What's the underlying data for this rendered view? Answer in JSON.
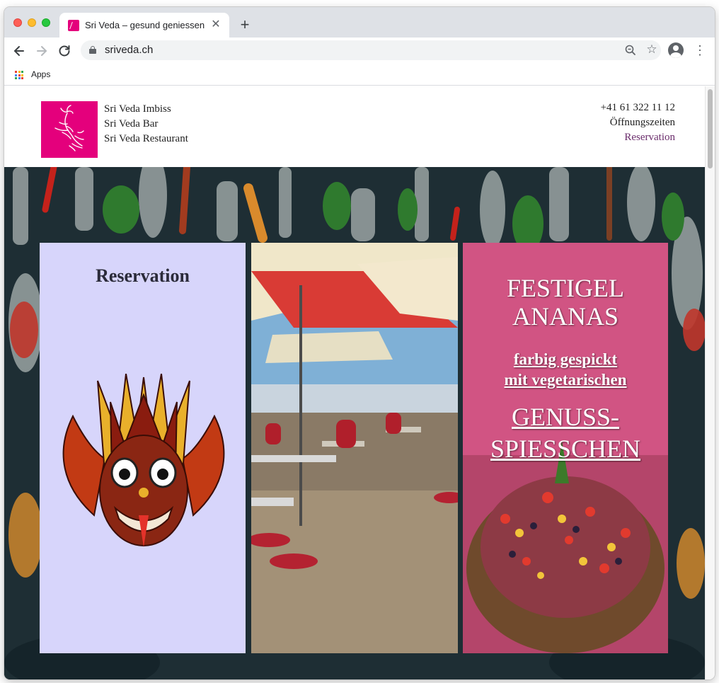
{
  "browser": {
    "tab_title": "Sri Veda – gesund geniessen",
    "url": "sriveda.ch",
    "bookmarks": [
      {
        "label": "Apps"
      }
    ]
  },
  "header": {
    "nav": [
      "Sri Veda Imbiss",
      "Sri Veda Bar",
      "Sri Veda Restaurant"
    ],
    "phone": "+41 61 322 11 12",
    "hours_label": "Öffnungszeiten",
    "reservation_label": "Reservation"
  },
  "panels": {
    "reservation": {
      "title": "Reservation"
    },
    "promo": {
      "title_line1": "FESTIGEL",
      "title_line2": "ANANAS",
      "sub_line1": "farbig gespickt",
      "sub_line2": "mit vegetarischen",
      "big_line1": "GENUSS-",
      "big_line2": "SPIESSCHEN"
    }
  },
  "colors": {
    "brand_magenta": "#e4007c",
    "reservation_bg": "#d7d5fb",
    "reservation_link": "#6a2c6b",
    "hero_bg": "#1d2d33"
  },
  "icons": [
    "back-icon",
    "forward-icon",
    "reload-icon",
    "lock-icon",
    "zoom-icon",
    "star-icon",
    "profile-icon",
    "menu-icon",
    "apps-icon"
  ]
}
